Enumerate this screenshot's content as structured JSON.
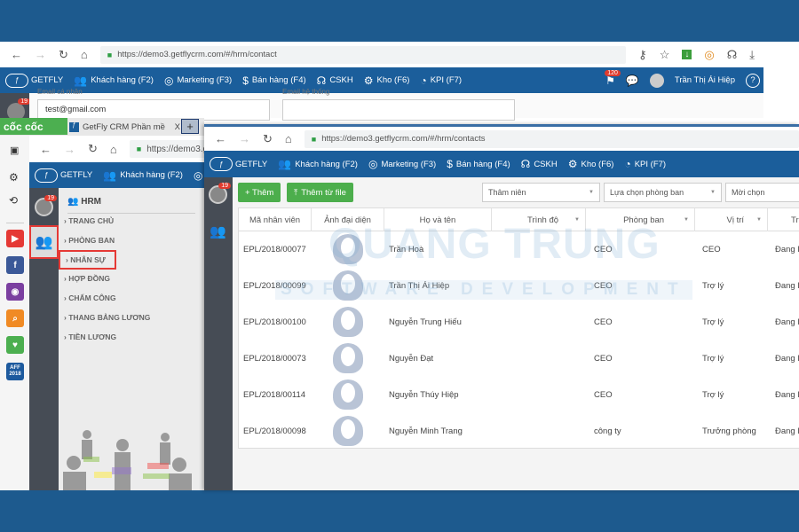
{
  "colors": {
    "frame": "#1d5a8e",
    "nav": "#1b5e9b",
    "green": "#4cae4c",
    "sidebar_dark": "#464c55",
    "highlight": "#e53935"
  },
  "back_window": {
    "url": "https://demo3.getflycrm.com/#/hrm/contact",
    "nav": {
      "logo": "GETFLY",
      "items": [
        "Khách hàng (F2)",
        "Marketing (F3)",
        "Bán hàng (F4)",
        "CSKH",
        "Kho (F6)",
        "KPI (F7)"
      ],
      "flag_badge": "120",
      "user": "Trần Thị Ái Hiệp"
    },
    "email_personal_label": "Email cá nhân",
    "email_personal_value": "test@gmail.com",
    "email_system_label": "Email hệ thống",
    "badge": "19"
  },
  "middle_window": {
    "browser_name": "cốc cốc",
    "tab_title": "GetFly CRM Phần mề",
    "tab_close": "X",
    "new_tab": "+",
    "url": "https://demo3.g",
    "nav": {
      "logo": "GETFLY",
      "item": "Khách hàng (F2)"
    },
    "badge": "19",
    "menu_title": "HRM",
    "menu_items": [
      "TRANG CHỦ",
      "PHÒNG BAN",
      "NHÂN SỰ",
      "HỢP ĐỒNG",
      "CHẤM CÔNG",
      "THANG BẢNG LƯƠNG",
      "TIỀN LƯƠNG"
    ],
    "selected": "NHÂN SỰ",
    "side_apps": [
      "youtube-icon",
      "facebook-icon",
      "browser-icon",
      "search-icon",
      "map-icon",
      "aff-icon"
    ],
    "aff_label": "AFF 2018"
  },
  "front_window": {
    "url": "https://demo3.getflycrm.com/#/hrm/contacts",
    "nav": {
      "logo": "GETFLY",
      "items": [
        "Khách hàng (F2)",
        "Marketing (F3)",
        "Bán hàng (F4)",
        "CSKH",
        "Kho (F6)",
        "KPI (F7)"
      ]
    },
    "badge": "19",
    "add_button": "+ Thêm",
    "import_button": "Thêm từ file",
    "filters": [
      "Thâm niên",
      "Lựa chọn phòng ban",
      "Mời chọn"
    ],
    "columns": [
      "Mã nhân viên",
      "Ảnh đại diện",
      "Họ và tên",
      "Trình độ",
      "Phòng ban",
      "Vị trí",
      "Tr"
    ],
    "rows": [
      {
        "id": "EPL/2018/00077",
        "name": "Trần Hoà",
        "dept": "CEO",
        "pos": "CEO",
        "status": "Đang l"
      },
      {
        "id": "EPL/2018/00099",
        "name": "Trần Thị Ái Hiệp",
        "dept": "CEO",
        "pos": "Trợ lý",
        "status": "Đang l"
      },
      {
        "id": "EPL/2018/00100",
        "name": "Nguyễn Trung Hiếu",
        "dept": "CEO",
        "pos": "Trợ lý",
        "status": "Đang l"
      },
      {
        "id": "EPL/2018/00073",
        "name": "Nguyễn Đạt",
        "dept": "CEO",
        "pos": "Trợ lý",
        "status": "Đang l"
      },
      {
        "id": "EPL/2018/00114",
        "name": "Nguyễn Thúy Hiệp",
        "dept": "CEO",
        "pos": "Trợ lý",
        "status": "Đang l"
      },
      {
        "id": "EPL/2018/00098",
        "name": "Nguyễn Minh Trang",
        "dept": "công ty",
        "pos": "Trưởng phòng",
        "status": "Đang l"
      }
    ]
  },
  "watermark": {
    "line1": "QUANG TRUNG",
    "line2": "SOFTWARE DEVELOPMENT"
  }
}
